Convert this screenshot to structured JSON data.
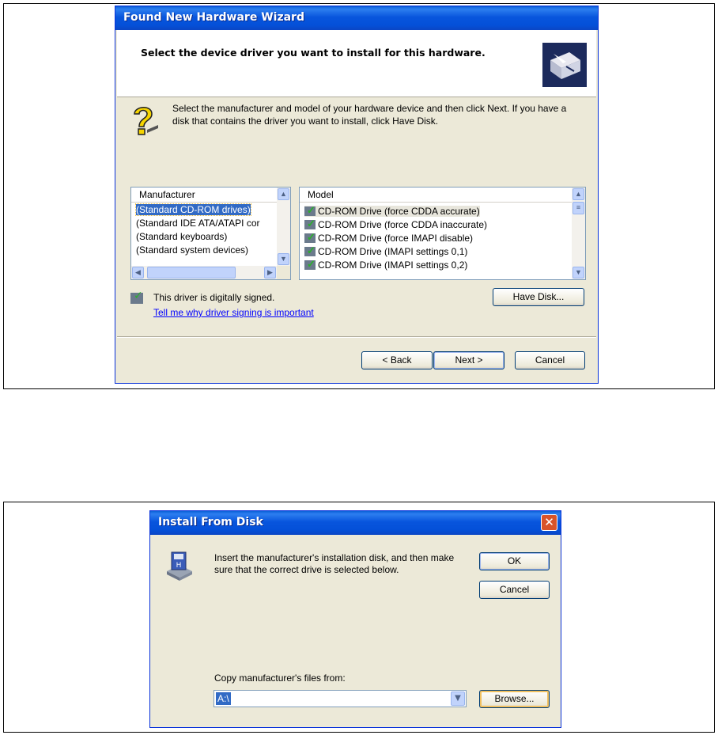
{
  "wizard": {
    "title": "Found New Hardware Wizard",
    "heading": "Select the device driver you want to install for this hardware.",
    "instructions": "Select the manufacturer and model of your hardware device and then click Next. If you have a disk that contains the driver you want to install, click Have Disk.",
    "manufacturer_header": "Manufacturer",
    "manufacturers": [
      "(Standard CD-ROM drives)",
      "(Standard IDE ATA/ATAPI cor",
      "(Standard keyboards)",
      "(Standard system devices)"
    ],
    "selected_manufacturer": "(Standard CD-ROM drives)",
    "model_header": "Model",
    "models": [
      "CD-ROM Drive (force CDDA accurate)",
      "CD-ROM Drive (force CDDA inaccurate)",
      "CD-ROM Drive (force IMAPI disable)",
      "CD-ROM Drive (IMAPI settings 0,1)",
      "CD-ROM Drive (IMAPI settings 0,2)"
    ],
    "signed_text": "This driver is digitally signed.",
    "signing_link": "Tell me why driver signing is important",
    "have_disk_label": "Have Disk...",
    "back_label": "< Back",
    "next_label": "Next >",
    "cancel_label": "Cancel"
  },
  "install_from_disk": {
    "title": "Install From Disk",
    "message": "Insert the manufacturer's installation disk, and then make sure that the correct drive is selected below.",
    "ok_label": "OK",
    "cancel_label": "Cancel",
    "copy_label": "Copy manufacturer's files from:",
    "path_value": "A:\\",
    "browse_label": "Browse..."
  },
  "icons": {
    "wizard_header": "hardware-wizard-icon",
    "help": "question-mark-icon",
    "signed": "signed-driver-icon",
    "disk": "floppy-disk-icon",
    "close": "close-icon"
  }
}
